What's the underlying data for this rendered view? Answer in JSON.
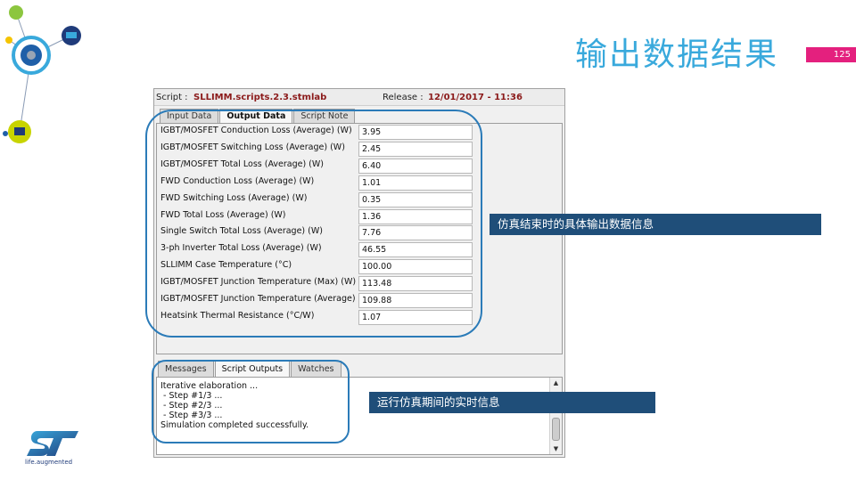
{
  "slide": {
    "title": "输出数据结果",
    "page_number": "125",
    "accent_color": "#e4207e",
    "title_color": "#39a9dc"
  },
  "app": {
    "script_label": "Script :",
    "script_value": "SLLIMM.scripts.2.3.stmlab",
    "release_label": "Release :",
    "release_value": "12/01/2017 - 11:36",
    "top_tabs": [
      "Input Data",
      "Output Data",
      "Script Note"
    ],
    "active_top_tab": "Output Data",
    "fields": [
      {
        "label": "IGBT/MOSFET Conduction Loss (Average) (W)",
        "value": "3.95"
      },
      {
        "label": "IGBT/MOSFET Switching Loss (Average) (W)",
        "value": "2.45"
      },
      {
        "label": "IGBT/MOSFET Total Loss (Average) (W)",
        "value": "6.40"
      },
      {
        "label": "FWD Conduction Loss (Average) (W)",
        "value": "1.01"
      },
      {
        "label": "FWD Switching Loss (Average) (W)",
        "value": "0.35"
      },
      {
        "label": "FWD Total Loss (Average) (W)",
        "value": "1.36"
      },
      {
        "label": "Single Switch Total Loss (Average) (W)",
        "value": "7.76"
      },
      {
        "label": "3-ph Inverter Total Loss (Average) (W)",
        "value": "46.55"
      },
      {
        "label": "SLLIMM Case Temperature (°C)",
        "value": "100.00"
      },
      {
        "label": "IGBT/MOSFET Junction Temperature (Max) (W)",
        "value": "113.48"
      },
      {
        "label": "IGBT/MOSFET Junction Temperature (Average)",
        "value": "109.88"
      },
      {
        "label": "Heatsink Thermal Resistance (°C/W)",
        "value": "1.07"
      }
    ],
    "bottom_tabs": [
      "Messages",
      "Script Outputs",
      "Watches"
    ],
    "active_bottom_tab": "Script Outputs",
    "output_text": "Iterative elaboration ...\n - Step #1/3 ...\n - Step #2/3 ...\n - Step #3/3 ...\nSimulation completed successfully."
  },
  "callouts": {
    "output_data_note": "仿真结束时的具体输出数据信息",
    "script_output_note": "运行仿真期间的实时信息"
  },
  "brand": {
    "logo": "ST",
    "tagline": "life.augmented"
  }
}
